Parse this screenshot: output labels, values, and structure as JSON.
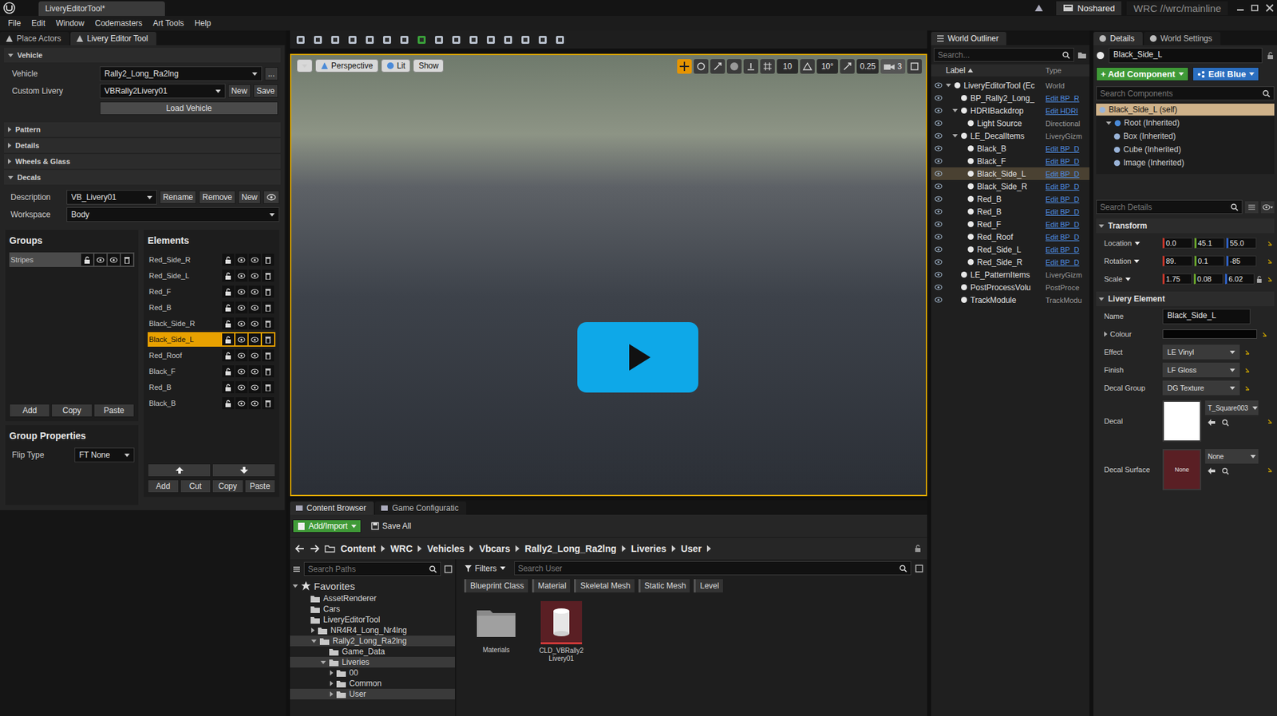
{
  "window": {
    "title": "LiveryEditorTool*",
    "user": "Noshared",
    "branch": "WRC //wrc/mainline"
  },
  "menu": [
    "File",
    "Edit",
    "Window",
    "Codemasters",
    "Art Tools",
    "Help"
  ],
  "left_tabs": [
    {
      "label": "Place Actors",
      "selected": false
    },
    {
      "label": "Livery Editor Tool",
      "selected": true
    }
  ],
  "vehicle": {
    "title": "Vehicle",
    "expanded": true,
    "vehicle_label": "Vehicle",
    "vehicle_value": "Rally2_Long_Ra2lng",
    "browse": "...",
    "livery_label": "Custom Livery",
    "livery_value": "VBRally2Livery01",
    "livery_buttons": [
      "New",
      "Save"
    ],
    "load": "Load Vehicle"
  },
  "sections": [
    {
      "title": "Pattern",
      "expanded": false
    },
    {
      "title": "Details",
      "expanded": false
    },
    {
      "title": "Wheels & Glass",
      "expanded": false
    }
  ],
  "decals": {
    "title": "Decals",
    "expanded": true,
    "description_label": "Description",
    "description_value": "VB_Livery01",
    "description_buttons": [
      "Rename",
      "Remove",
      "New"
    ],
    "workspace_label": "Workspace",
    "workspace_value": "Body",
    "groups": {
      "title": "Groups",
      "items": [
        {
          "label": "Stripes",
          "selected": true
        }
      ],
      "buttons": [
        "Add",
        "Copy",
        "Paste"
      ]
    },
    "elements": {
      "title": "Elements",
      "items": [
        {
          "label": "Red_Side_R",
          "selected": false
        },
        {
          "label": "Red_Side_L",
          "selected": false
        },
        {
          "label": "Red_F",
          "selected": false
        },
        {
          "label": "Red_B",
          "selected": false
        },
        {
          "label": "Black_Side_R",
          "selected": false
        },
        {
          "label": "Black_Side_L",
          "selected": true
        },
        {
          "label": "Red_Roof",
          "selected": false
        },
        {
          "label": "Black_F",
          "selected": false
        },
        {
          "label": "Red_B",
          "selected": false
        },
        {
          "label": "Black_B",
          "selected": false
        }
      ],
      "buttons": [
        "Add",
        "Cut",
        "Copy",
        "Paste"
      ]
    },
    "group_properties": {
      "title": "Group Properties",
      "flip_label": "Flip Type",
      "flip_value": "FT None"
    }
  },
  "viewport": {
    "view": "Perspective",
    "mode": "Lit",
    "show": "Show",
    "grid_snap": "10",
    "rotation_snap": "10°",
    "scale_snap": "0.25",
    "camera_speed": "3",
    "selected": true
  },
  "content_browser": {
    "tabs": [
      {
        "label": "Content Browser",
        "selected": true
      },
      {
        "label": "Game Configuratic",
        "selected": false
      }
    ],
    "add_import": "Add/Import",
    "save_all": "Save All",
    "breadcrumb": [
      "Content",
      "WRC",
      "Vehicles",
      "Vbcars",
      "Rally2_Long_Ra2lng",
      "Liveries",
      "User"
    ],
    "search_paths": "Search Paths",
    "filters": "Filters",
    "search": "Search User",
    "filter_chips": [
      "Blueprint Class",
      "Material",
      "Skeletal Mesh",
      "Static Mesh",
      "Level"
    ],
    "tree": [
      {
        "label": "Favorites",
        "indent": 0,
        "kind": "favorites",
        "expandable": true,
        "expanded": true,
        "selected": false
      },
      {
        "label": "AssetRenderer",
        "indent": 1,
        "kind": "folder",
        "expandable": false,
        "expanded": false,
        "selected": false
      },
      {
        "label": "Cars",
        "indent": 1,
        "kind": "folder",
        "expandable": false,
        "expanded": false,
        "selected": false
      },
      {
        "label": "LiveryEditorTool",
        "indent": 1,
        "kind": "folder",
        "expandable": false,
        "expanded": false,
        "selected": false
      },
      {
        "label": "NR4R4_Long_Nr4lng",
        "indent": 2,
        "kind": "folder",
        "expandable": true,
        "expanded": false,
        "selected": false
      },
      {
        "label": "Rally2_Long_Ra2lng",
        "indent": 2,
        "kind": "folder",
        "expandable": true,
        "expanded": true,
        "selected": true
      },
      {
        "label": "Game_Data",
        "indent": 3,
        "kind": "folder",
        "expandable": false,
        "expanded": false,
        "selected": false
      },
      {
        "label": "Liveries",
        "indent": 3,
        "kind": "folder",
        "expandable": true,
        "expanded": true,
        "selected": true
      },
      {
        "label": "00",
        "indent": 4,
        "kind": "folder",
        "expandable": true,
        "expanded": false,
        "selected": false
      },
      {
        "label": "Common",
        "indent": 4,
        "kind": "folder",
        "expandable": true,
        "expanded": false,
        "selected": false
      },
      {
        "label": "User",
        "indent": 4,
        "kind": "folder",
        "expandable": true,
        "expanded": false,
        "selected": true
      }
    ],
    "assets": [
      {
        "label": "Materials",
        "kind": "folder"
      },
      {
        "label": "CLD_VBRally2 Livery01",
        "kind": "asset"
      }
    ]
  },
  "outliner": {
    "title": "World Outliner",
    "search": "Search...",
    "columns": [
      "Label",
      "Type"
    ],
    "rows": [
      {
        "label": "LiveryEditorTool (Ec",
        "type": "World",
        "link": false,
        "indent": 0,
        "expandable": true,
        "expanded": true,
        "selected": false
      },
      {
        "label": "BP_Rally2_Long_",
        "type": "Edit BP_R",
        "link": true,
        "indent": 1,
        "expandable": false,
        "expanded": false,
        "selected": false
      },
      {
        "label": "HDRIBackdrop",
        "type": "Edit HDRI",
        "link": true,
        "indent": 1,
        "expandable": true,
        "expanded": true,
        "selected": false
      },
      {
        "label": "Light Source",
        "type": "Directional",
        "link": false,
        "indent": 2,
        "expandable": false,
        "expanded": false,
        "selected": false
      },
      {
        "label": "LE_DecalItems",
        "type": "LiveryGizm",
        "link": false,
        "indent": 1,
        "expandable": true,
        "expanded": true,
        "selected": false
      },
      {
        "label": "Black_B",
        "type": "Edit BP_D",
        "link": true,
        "indent": 2,
        "expandable": false,
        "expanded": false,
        "selected": false
      },
      {
        "label": "Black_F",
        "type": "Edit BP_D",
        "link": true,
        "indent": 2,
        "expandable": false,
        "expanded": false,
        "selected": false
      },
      {
        "label": "Black_Side_L",
        "type": "Edit BP_D",
        "link": true,
        "indent": 2,
        "expandable": false,
        "expanded": false,
        "selected": true
      },
      {
        "label": "Black_Side_R",
        "type": "Edit BP_D",
        "link": true,
        "indent": 2,
        "expandable": false,
        "expanded": false,
        "selected": false
      },
      {
        "label": "Red_B",
        "type": "Edit BP_D",
        "link": true,
        "indent": 2,
        "expandable": false,
        "expanded": false,
        "selected": false
      },
      {
        "label": "Red_B",
        "type": "Edit BP_D",
        "link": true,
        "indent": 2,
        "expandable": false,
        "expanded": false,
        "selected": false
      },
      {
        "label": "Red_F",
        "type": "Edit BP_D",
        "link": true,
        "indent": 2,
        "expandable": false,
        "expanded": false,
        "selected": false
      },
      {
        "label": "Red_Roof",
        "type": "Edit BP_D",
        "link": true,
        "indent": 2,
        "expandable": false,
        "expanded": false,
        "selected": false
      },
      {
        "label": "Red_Side_L",
        "type": "Edit BP_D",
        "link": true,
        "indent": 2,
        "expandable": false,
        "expanded": false,
        "selected": false
      },
      {
        "label": "Red_Side_R",
        "type": "Edit BP_D",
        "link": true,
        "indent": 2,
        "expandable": false,
        "expanded": false,
        "selected": false
      },
      {
        "label": "LE_PatternItems",
        "type": "LiveryGizm",
        "link": false,
        "indent": 1,
        "expandable": false,
        "expanded": false,
        "selected": false
      },
      {
        "label": "PostProcessVolu",
        "type": "PostProce",
        "link": false,
        "indent": 1,
        "expandable": false,
        "expanded": false,
        "selected": false
      },
      {
        "label": "TrackModule",
        "type": "TrackModu",
        "link": false,
        "indent": 1,
        "expandable": false,
        "expanded": false,
        "selected": false
      }
    ]
  },
  "details": {
    "tabs": [
      {
        "label": "Details",
        "selected": true
      },
      {
        "label": "World Settings",
        "selected": false
      }
    ],
    "name": "Black_Side_L",
    "add_component": "+ Add Component",
    "edit_blueprint": "Edit Blue",
    "search_components": "Search Components",
    "components": [
      {
        "label": "Black_Side_L (self)",
        "indent": 0,
        "selected": true
      },
      {
        "label": "Root (Inherited)",
        "indent": 1,
        "selected": false
      },
      {
        "label": "Box (Inherited)",
        "indent": 2,
        "selected": false
      },
      {
        "label": "Cube (Inherited)",
        "indent": 2,
        "selected": false
      },
      {
        "label": "Image (Inherited)",
        "indent": 2,
        "selected": false
      }
    ],
    "search_details": "Search Details",
    "transform_title": "Transform",
    "transform": [
      {
        "label": "Location",
        "values": [
          "0.0",
          "45.1",
          "55.0"
        ],
        "locked": false
      },
      {
        "label": "Rotation",
        "values": [
          "89.",
          "0.1",
          "-85"
        ],
        "locked": false
      },
      {
        "label": "Scale",
        "values": [
          "1.75",
          "0.08",
          "6.02"
        ],
        "locked": true
      }
    ],
    "livery_title": "Livery Element",
    "properties": [
      {
        "label": "Name",
        "kind": "text",
        "value": "Black_Side_L"
      },
      {
        "label": "Colour",
        "kind": "color",
        "value": "",
        "color": "#050505"
      },
      {
        "label": "Effect",
        "kind": "dropdown",
        "value": "LE Vinyl"
      },
      {
        "label": "Finish",
        "kind": "dropdown",
        "value": "LF Gloss"
      },
      {
        "label": "Decal Group",
        "kind": "dropdown",
        "value": "DG Texture"
      },
      {
        "label": "Decal",
        "kind": "texture",
        "value": "T_Square003",
        "thumb_text": "",
        "color": "#ffffff"
      },
      {
        "label": "Decal Surface",
        "kind": "texture",
        "value": "None",
        "thumb_text": "None",
        "color": "#5a1f24"
      }
    ]
  }
}
